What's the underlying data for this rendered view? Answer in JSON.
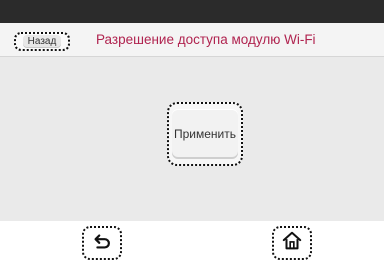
{
  "header": {
    "back_label": "Назад",
    "title": "Разрешение доступа модулю Wi-Fi"
  },
  "main": {
    "apply_label": "Применить"
  },
  "footer": {
    "back_icon": "return-arrow-icon",
    "home_icon": "home-icon"
  },
  "colors": {
    "title": "#b0234f",
    "topbar": "#2b2b2b",
    "content_bg": "#eaeaea"
  }
}
